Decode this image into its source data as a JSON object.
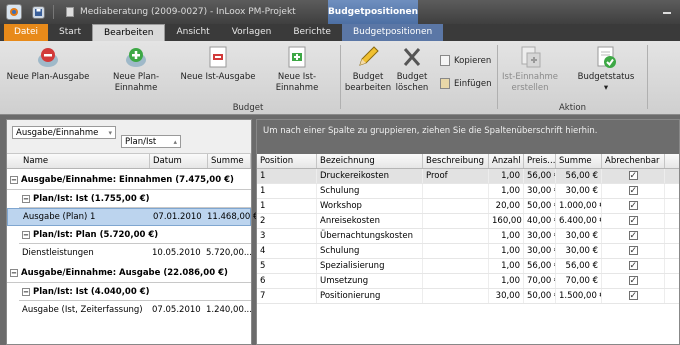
{
  "window": {
    "title": "Mediaberatung (2009-0027) - InLoox PM-Projekt",
    "context_tab_header": "Budgetpositionen"
  },
  "tabs": [
    "Datei",
    "Start",
    "Bearbeiten",
    "Ansicht",
    "Vorlagen",
    "Berichte",
    "Budgetpositionen"
  ],
  "ribbon": {
    "budget_group_label": "Budget",
    "aktion_group_label": "Aktion",
    "buttons": {
      "neue_plan_ausgabe": "Neue Plan-Ausgabe",
      "neue_plan_einnahme": "Neue Plan-Einnahme",
      "neue_ist_ausgabe": "Neue Ist-Ausgabe",
      "neue_ist_einnahme": "Neue Ist-Einnahme",
      "budget_bearbeiten_1": "Budget",
      "budget_bearbeiten_2": "bearbeiten",
      "budget_loeschen_1": "Budget",
      "budget_loeschen_2": "löschen",
      "kopieren": "Kopieren",
      "einfuegen": "Einfügen",
      "ist_einnahme_erstellen_1": "Ist-Einnahme",
      "ist_einnahme_erstellen_2": "erstellen",
      "budgetstatus": "Budgetstatus"
    }
  },
  "left_panel": {
    "group_chips": [
      "Ausgabe/Einnahme",
      "Plan/Ist"
    ],
    "columns": [
      "Name",
      "Datum",
      "Summe"
    ],
    "rows": [
      {
        "type": "group",
        "level": 0,
        "label": "Ausgabe/Einnahme: Einnahmen (7.475,00 €)"
      },
      {
        "type": "group",
        "level": 1,
        "label": "Plan/Ist: Ist (1.755,00 €)"
      },
      {
        "type": "item",
        "name": "Ausgabe (Plan) 1",
        "datum": "07.01.2010",
        "summe": "11.468,00 €",
        "selected": true
      },
      {
        "type": "group",
        "level": 1,
        "label": "Plan/Ist: Plan (5.720,00 €)"
      },
      {
        "type": "item",
        "name": "Dienstleistungen",
        "datum": "10.05.2010",
        "summe": "5.720,00...",
        "selected": false
      },
      {
        "type": "group",
        "level": 0,
        "label": "Ausgabe/Einnahme: Ausgabe (22.086,00 €)"
      },
      {
        "type": "group",
        "level": 1,
        "label": "Plan/Ist: Ist (4.040,00 €)"
      },
      {
        "type": "item",
        "name": "Ausgabe (Ist, Zeiterfassung)",
        "datum": "07.05.2010",
        "summe": "1.240,00...",
        "selected": false
      }
    ]
  },
  "right_panel": {
    "group_hint": "Um nach einer Spalte zu gruppieren, ziehen Sie die Spaltenüberschrift hierhin.",
    "columns": [
      "Position",
      "Bezeichnung",
      "Beschreibung",
      "Anzahl",
      "Preis...",
      "Summe",
      "Abrechenbar"
    ],
    "rows": [
      {
        "position": "1",
        "bezeichnung": "Druckereikosten",
        "beschreibung": "Proof",
        "anzahl": "1,00",
        "preis": "56,00 €",
        "summe": "56,00 €",
        "abrechenbar": true
      },
      {
        "position": "1",
        "bezeichnung": "Schulung",
        "beschreibung": "",
        "anzahl": "1,00",
        "preis": "30,00 €",
        "summe": "30,00 €",
        "abrechenbar": true
      },
      {
        "position": "1",
        "bezeichnung": "Workshop",
        "beschreibung": "",
        "anzahl": "20,00",
        "preis": "50,00 €",
        "summe": "1.000,00 €",
        "abrechenbar": true
      },
      {
        "position": "2",
        "bezeichnung": "Anreisekosten",
        "beschreibung": "",
        "anzahl": "160,00",
        "preis": "40,00 €",
        "summe": "6.400,00 €",
        "abrechenbar": true
      },
      {
        "position": "3",
        "bezeichnung": "Übernachtungskosten",
        "beschreibung": "",
        "anzahl": "1,00",
        "preis": "30,00 €",
        "summe": "30,00 €",
        "abrechenbar": true
      },
      {
        "position": "4",
        "bezeichnung": "Schulung",
        "beschreibung": "",
        "anzahl": "1,00",
        "preis": "30,00 €",
        "summe": "30,00 €",
        "abrechenbar": true
      },
      {
        "position": "5",
        "bezeichnung": "Spezialisierung",
        "beschreibung": "",
        "anzahl": "1,00",
        "preis": "56,00 €",
        "summe": "56,00 €",
        "abrechenbar": true
      },
      {
        "position": "6",
        "bezeichnung": "Umsetzung",
        "beschreibung": "",
        "anzahl": "1,00",
        "preis": "70,00 €",
        "summe": "70,00 €",
        "abrechenbar": true
      },
      {
        "position": "7",
        "bezeichnung": "Positionierung",
        "beschreibung": "",
        "anzahl": "30,00",
        "preis": "50,00 €",
        "summe": "1.500,00 €",
        "abrechenbar": true
      }
    ]
  },
  "colors": {
    "file_tab": "#e88a1a",
    "context_tab": "#5b77a6",
    "selection": "#bcd4ee"
  }
}
